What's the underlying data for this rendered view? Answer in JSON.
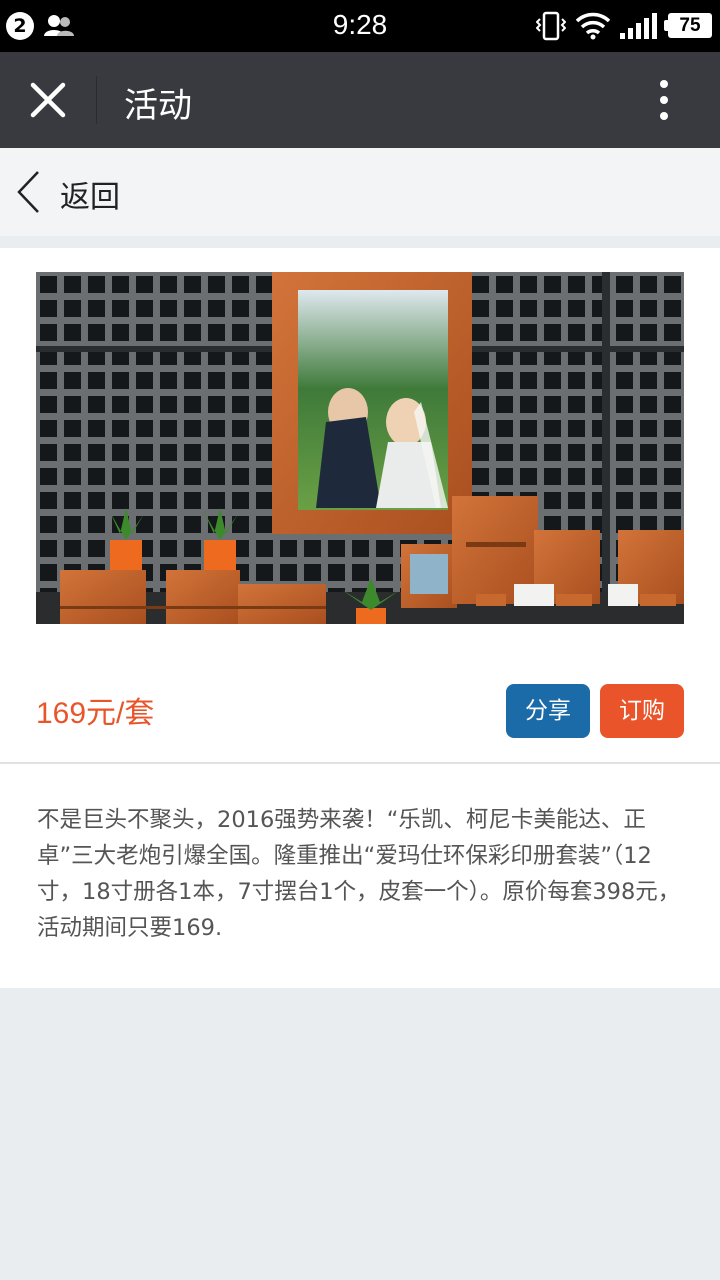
{
  "status_bar": {
    "notification_count": "2",
    "time": "9:28",
    "battery": "75"
  },
  "title_bar": {
    "title": "活动"
  },
  "back_bar": {
    "back_label": "返回"
  },
  "product": {
    "price": "169元/套",
    "share_label": "分享",
    "order_label": "订购",
    "description": "不是巨头不聚头，2016强势来袭！“乐凯、柯尼卡美能达、正卓”三大老炮引爆全国。隆重推出“爱玛仕环保彩印册套装”（12寸，18寸册各1本，7寸摆台1个，皮套一个）。原价每套398元，活动期间只要169."
  },
  "colors": {
    "price": "#e8552a",
    "share_button": "#1a6ba8",
    "order_button": "#e9542a",
    "title_bar": "#393a3f"
  },
  "icons": [
    "notification-badge",
    "contacts-icon",
    "vibrate-icon",
    "wifi-icon",
    "signal-icon",
    "battery-icon",
    "close-icon",
    "more-icon",
    "chevron-left-icon"
  ]
}
